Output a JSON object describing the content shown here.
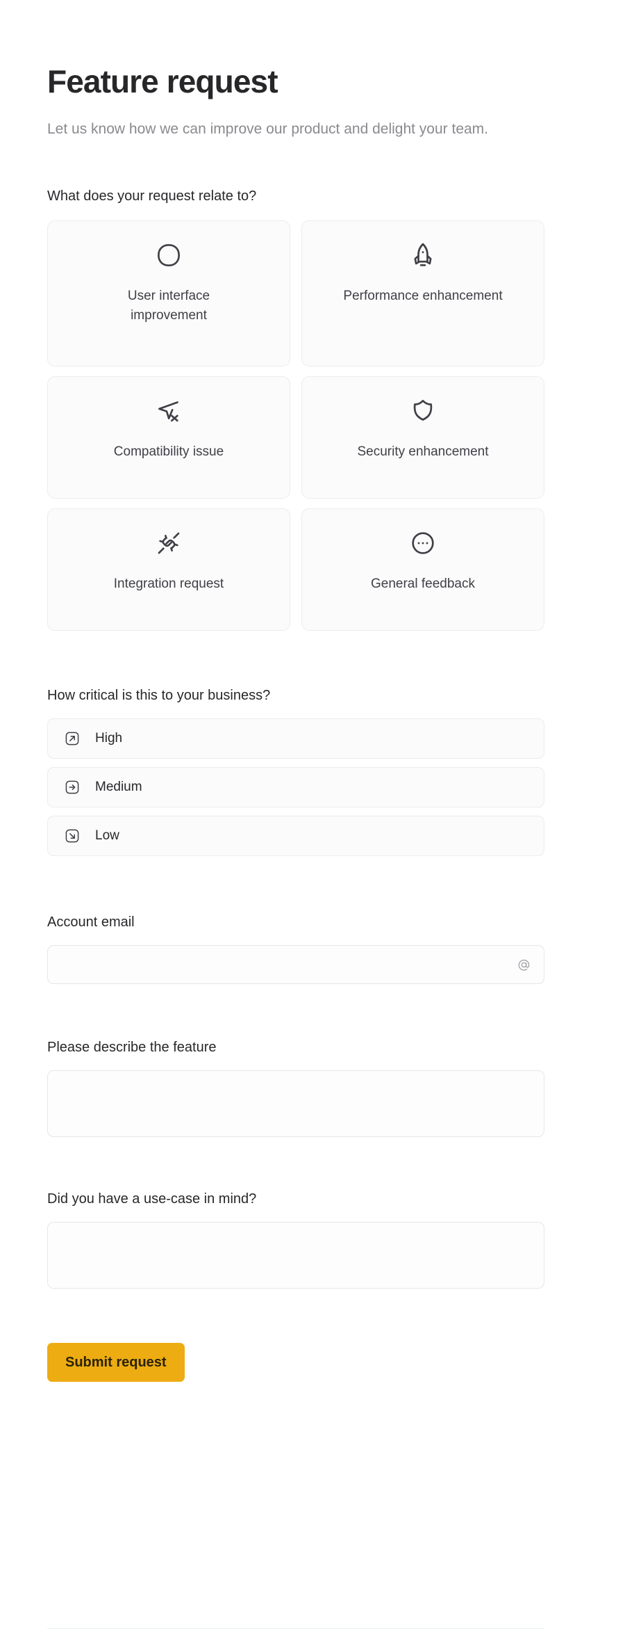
{
  "header": {
    "title": "Feature request",
    "subtitle": "Let us know how we can improve our product and delight your team."
  },
  "category": {
    "label": "What does your request relate to?",
    "options": [
      {
        "label": "User interface improvement",
        "icon": "squircle-icon"
      },
      {
        "label": "Performance enhancement",
        "icon": "rocket-icon"
      },
      {
        "label": "Compatibility issue",
        "icon": "send-x-icon"
      },
      {
        "label": "Security enhancement",
        "icon": "shield-icon"
      },
      {
        "label": "Integration request",
        "icon": "plug-connected-icon"
      },
      {
        "label": "General feedback",
        "icon": "dots-circle-icon"
      }
    ]
  },
  "priority": {
    "label": "How critical is this to your business?",
    "options": [
      {
        "label": "High",
        "icon": "arrow-up-right-square-icon"
      },
      {
        "label": "Medium",
        "icon": "arrow-right-square-icon"
      },
      {
        "label": "Low",
        "icon": "arrow-down-right-square-icon"
      }
    ]
  },
  "email": {
    "label": "Account email",
    "value": "",
    "placeholder": "",
    "icon": "at-icon"
  },
  "description": {
    "label": "Please describe the feature",
    "value": "",
    "placeholder": ""
  },
  "usecase": {
    "label": "Did you have a use-case in mind?",
    "value": "",
    "placeholder": ""
  },
  "submit": {
    "label": "Submit request",
    "color": "#eeac13"
  }
}
